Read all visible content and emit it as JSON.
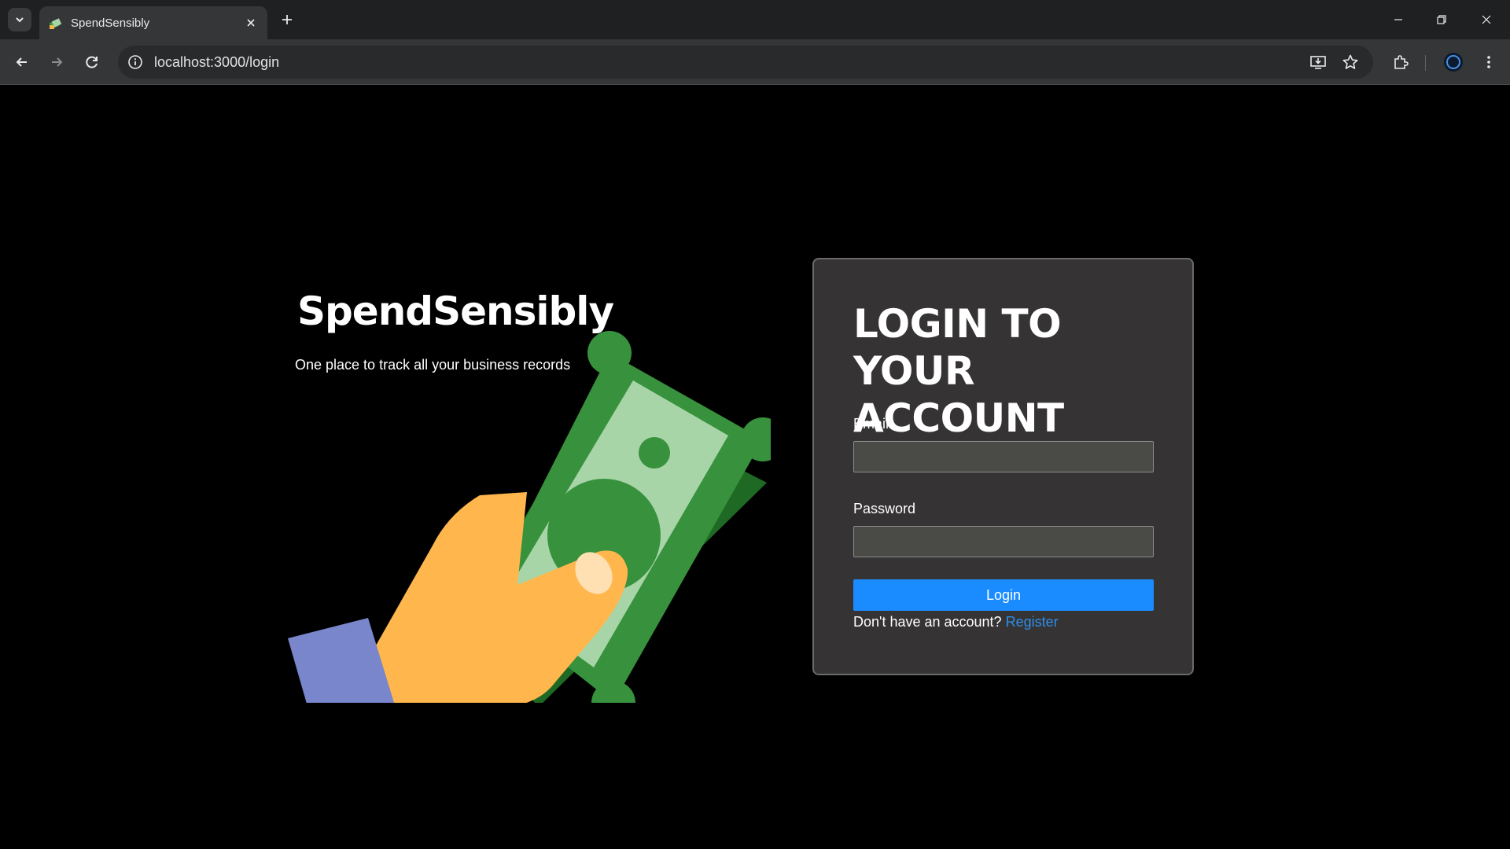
{
  "browser": {
    "tab_title": "SpendSensibly",
    "url": "localhost:3000/login"
  },
  "brand": {
    "name": "SpendSensibly",
    "tagline": "One place to track all your business records"
  },
  "login": {
    "heading": "LOGIN TO YOUR ACCOUNT",
    "email_label": "Email",
    "email_value": "",
    "password_label": "Password",
    "password_value": "",
    "submit_label": "Login",
    "register_prompt": "Don't have an account?",
    "register_link": "Register"
  },
  "colors": {
    "page_background": "#000000",
    "card_background": "#353334",
    "accent": "#1a8cff",
    "link": "#2e8ee8"
  },
  "icons": [
    "tab-list-icon",
    "favicon-icon",
    "close-icon",
    "plus-icon",
    "minimize-icon",
    "restore-icon",
    "back-icon",
    "forward-icon",
    "reload-icon",
    "info-icon",
    "install-icon",
    "star-icon",
    "extensions-icon",
    "profile-icon",
    "menu-icon"
  ]
}
